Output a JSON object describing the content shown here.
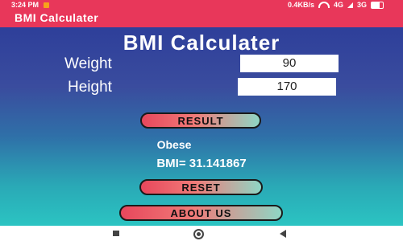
{
  "status_bar": {
    "time": "3:24 PM",
    "network_speed": "0.4KB/s",
    "network_type_1": "4G",
    "network_type_2": "3G"
  },
  "app_bar": {
    "title": "BMI Calculater"
  },
  "main": {
    "heading": "BMI Calculater",
    "weight_label": "Weight",
    "weight_value": "90",
    "height_label": "Height",
    "height_value": "170",
    "result_button": "RESULT",
    "category": "Obese",
    "bmi_text": "BMI= 31.141867",
    "reset_button": "RESET",
    "about_button": "ABOUT US"
  },
  "colors": {
    "accent": "#e8375a",
    "gradient_top": "#2e3f9a",
    "gradient_bottom": "#2bc4c2"
  },
  "nav_icons": [
    "recent-apps-icon",
    "home-icon",
    "back-icon"
  ]
}
